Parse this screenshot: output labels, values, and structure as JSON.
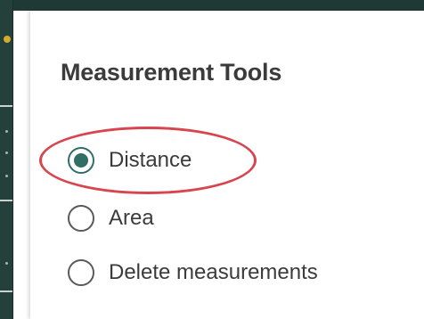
{
  "panel": {
    "title": "Measurement Tools"
  },
  "options": [
    {
      "label": "Distance",
      "checked": true
    },
    {
      "label": "Area",
      "checked": false
    },
    {
      "label": "Delete measurements",
      "checked": false
    }
  ],
  "colors": {
    "accent": "#2f6f66",
    "highlight": "#d9454e",
    "rail": "#23403a"
  },
  "icons": {
    "radio_selected": "radio-selected-icon",
    "radio_unselected": "radio-unselected-icon"
  }
}
